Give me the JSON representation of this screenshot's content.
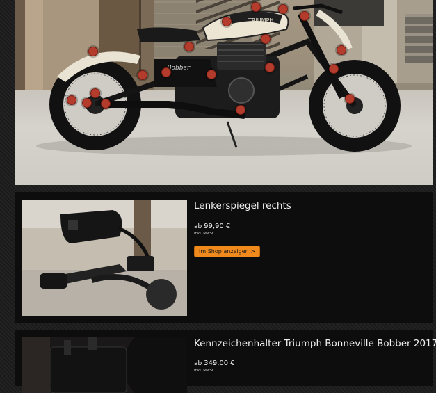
{
  "hero": {
    "hotspots": [
      {
        "name": "hotspot-1"
      },
      {
        "name": "hotspot-2"
      },
      {
        "name": "hotspot-3"
      },
      {
        "name": "hotspot-4"
      },
      {
        "name": "hotspot-5"
      },
      {
        "name": "hotspot-6"
      },
      {
        "name": "hotspot-7"
      },
      {
        "name": "hotspot-8"
      },
      {
        "name": "hotspot-9"
      },
      {
        "name": "hotspot-10"
      },
      {
        "name": "hotspot-11"
      },
      {
        "name": "hotspot-12"
      },
      {
        "name": "hotspot-13"
      },
      {
        "name": "hotspot-14"
      },
      {
        "name": "hotspot-15"
      },
      {
        "name": "hotspot-16"
      },
      {
        "name": "hotspot-17"
      },
      {
        "name": "hotspot-18"
      },
      {
        "name": "hotspot-19"
      }
    ],
    "tank_badge": "TRIUMPH",
    "side_badge": "Bobber",
    "hotspot_color": "#b43c2c"
  },
  "products": [
    {
      "title": "Lenkerspiegel rechts",
      "price_prefix": "ab",
      "price": "99,90 €",
      "tax_note": "inkl. MwSt.",
      "button_label": "Im Shop anzeigen >"
    },
    {
      "title": "Kennzeichenhalter Triumph Bonneville Bobber 2017-",
      "price_prefix": "ab",
      "price": "349,00 €",
      "tax_note": "inkl. MwSt."
    }
  ],
  "colors": {
    "button": "#f08a1d",
    "card_bg": "#0d0d0d",
    "page_bg": "#1d1d1d"
  }
}
